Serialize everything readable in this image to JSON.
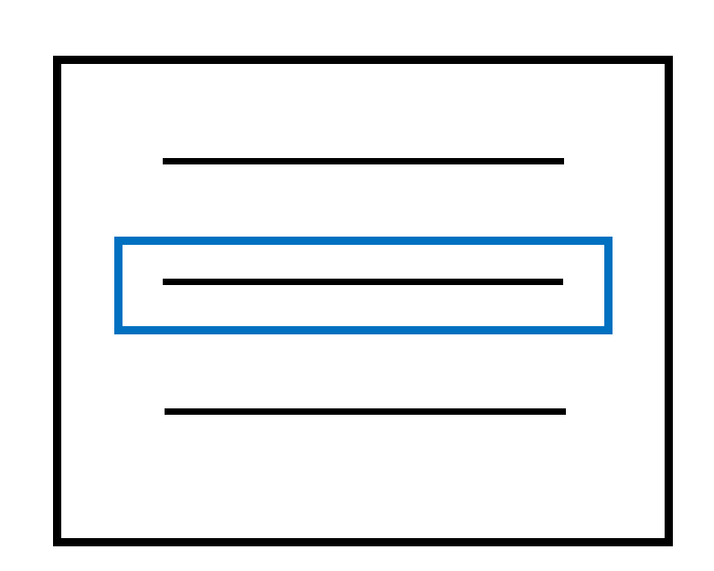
{
  "diagram": {
    "outer_frame": {
      "stroke_color": "#000000",
      "fill_color": "#ffffff"
    },
    "text_lines": {
      "count": 3,
      "color": "#000000"
    },
    "highlight": {
      "selected_line_index": 1,
      "stroke_color": "#0070c0"
    }
  }
}
